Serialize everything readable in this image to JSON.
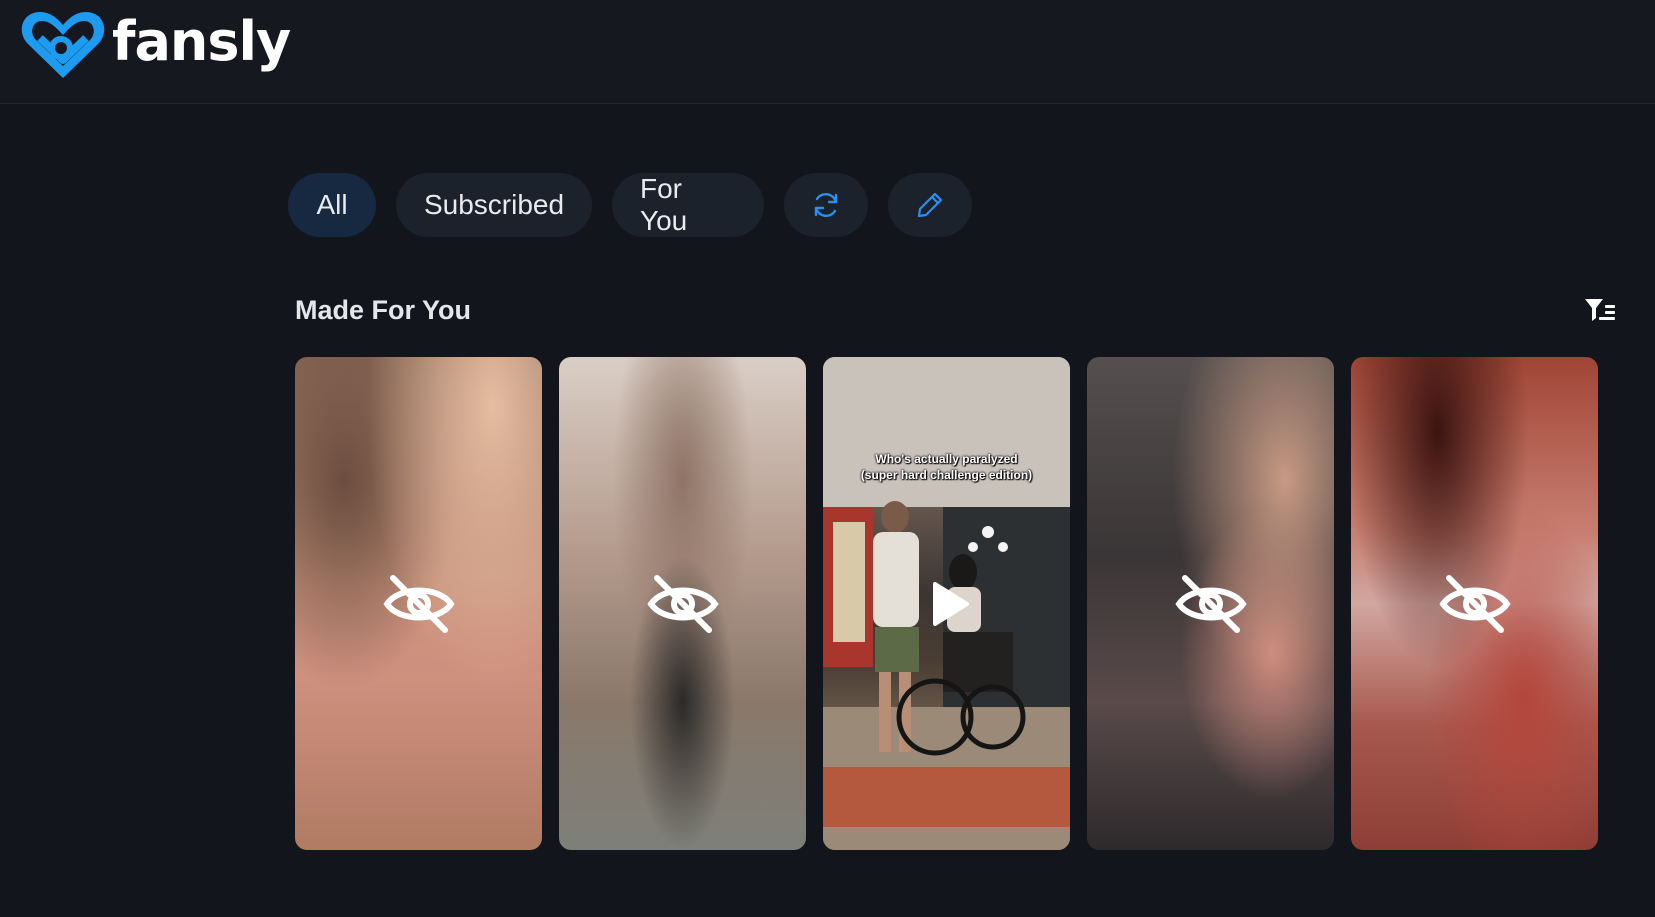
{
  "header": {
    "logo_text": "fansly",
    "brand_color": "#1d9bf0"
  },
  "tabs": [
    {
      "label": "All",
      "active": true
    },
    {
      "label": "Subscribed",
      "active": false
    },
    {
      "label": "For You",
      "active": false
    }
  ],
  "tab_icons": {
    "refresh": "refresh-icon",
    "edit": "pencil-icon"
  },
  "section": {
    "title": "Made For You",
    "filter_icon": "filter-list-icon"
  },
  "cards": [
    {
      "type": "hidden",
      "icon": "eye-slash-icon"
    },
    {
      "type": "hidden",
      "icon": "eye-slash-icon"
    },
    {
      "type": "video",
      "icon": "play-icon",
      "caption_line1": "Who's actually paralyzed",
      "caption_line2": "(super hard challenge edition)"
    },
    {
      "type": "hidden",
      "icon": "eye-slash-icon"
    },
    {
      "type": "hidden",
      "icon": "eye-slash-icon"
    }
  ]
}
